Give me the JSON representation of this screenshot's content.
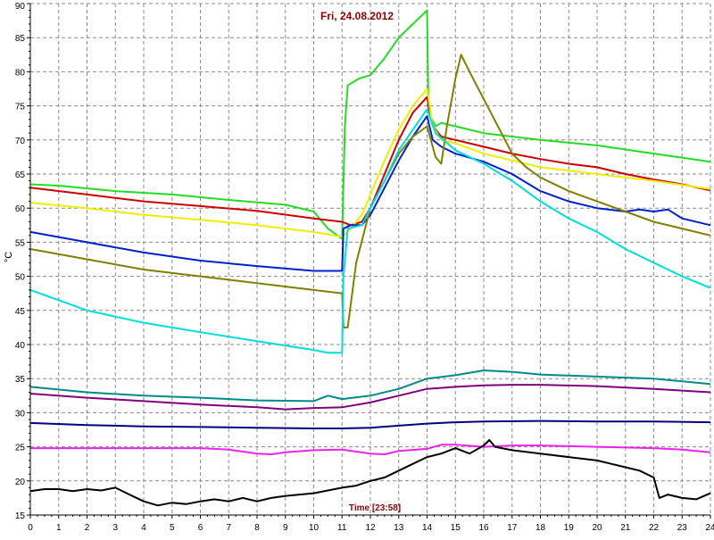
{
  "chart_data": {
    "type": "line",
    "title": "Fri, 24.08.2012",
    "ylabel": "°C",
    "xlabel": "Time [23:58]",
    "xlim": [
      0,
      24
    ],
    "ylim": [
      15,
      90
    ],
    "x_ticks": [
      0,
      1,
      2,
      3,
      4,
      5,
      6,
      7,
      8,
      9,
      10,
      11,
      12,
      13,
      14,
      15,
      16,
      17,
      18,
      19,
      20,
      21,
      22,
      23,
      24
    ],
    "y_ticks": [
      15,
      20,
      25,
      30,
      35,
      40,
      45,
      50,
      55,
      60,
      65,
      70,
      75,
      80,
      85,
      90
    ],
    "grid": true,
    "series": [
      {
        "color": "#22dd22",
        "points": [
          [
            0,
            63.5
          ],
          [
            1,
            63.3
          ],
          [
            3,
            62.5
          ],
          [
            5,
            62
          ],
          [
            7,
            61.2
          ],
          [
            9,
            60.5
          ],
          [
            10,
            59.5
          ],
          [
            10.5,
            57
          ],
          [
            11,
            55.5
          ],
          [
            11.1,
            72
          ],
          [
            11.2,
            78
          ],
          [
            11.6,
            79
          ],
          [
            12,
            79.5
          ],
          [
            12.5,
            82
          ],
          [
            13,
            85
          ],
          [
            13.5,
            87
          ],
          [
            14,
            89
          ],
          [
            14.05,
            74
          ],
          [
            14.3,
            72
          ],
          [
            14.5,
            72.5
          ],
          [
            15,
            72
          ],
          [
            16,
            71
          ],
          [
            18,
            70
          ],
          [
            20,
            69.2
          ],
          [
            22,
            68
          ],
          [
            24,
            66.8
          ]
        ]
      },
      {
        "color": "#cc0000",
        "points": [
          [
            0,
            63
          ],
          [
            2,
            62
          ],
          [
            4,
            61
          ],
          [
            6,
            60.3
          ],
          [
            8,
            59.6
          ],
          [
            10,
            58.5
          ],
          [
            11,
            58
          ],
          [
            11.3,
            57.5
          ],
          [
            11.7,
            58
          ],
          [
            12,
            60
          ],
          [
            12.5,
            65
          ],
          [
            13,
            70
          ],
          [
            13.5,
            74
          ],
          [
            14,
            76.3
          ],
          [
            14.2,
            72
          ],
          [
            14.5,
            70.5
          ],
          [
            15,
            70
          ],
          [
            16,
            69
          ],
          [
            17,
            68
          ],
          [
            18,
            67.2
          ],
          [
            19,
            66.5
          ],
          [
            20,
            66
          ],
          [
            21,
            65
          ],
          [
            22,
            64.2
          ],
          [
            23,
            63.5
          ],
          [
            24,
            62.6
          ]
        ]
      },
      {
        "color": "#eeee00",
        "points": [
          [
            0,
            60.8
          ],
          [
            2,
            60
          ],
          [
            4,
            59
          ],
          [
            6,
            58.3
          ],
          [
            8,
            57.5
          ],
          [
            10,
            56.5
          ],
          [
            11,
            55.8
          ],
          [
            11.3,
            57
          ],
          [
            11.7,
            59
          ],
          [
            12,
            62
          ],
          [
            12.5,
            67
          ],
          [
            13,
            71.5
          ],
          [
            13.5,
            75
          ],
          [
            14,
            77.5
          ],
          [
            14.2,
            72
          ],
          [
            14.5,
            70
          ],
          [
            15,
            69.5
          ],
          [
            16,
            68
          ],
          [
            17,
            67
          ],
          [
            18,
            66
          ],
          [
            20,
            65
          ],
          [
            22,
            64
          ],
          [
            24,
            62.8
          ]
        ]
      },
      {
        "color": "#0022cc",
        "points": [
          [
            0,
            56.5
          ],
          [
            2,
            55
          ],
          [
            4,
            53.5
          ],
          [
            6,
            52.3
          ],
          [
            8,
            51.5
          ],
          [
            10,
            50.8
          ],
          [
            11,
            50.8
          ],
          [
            11.05,
            57
          ],
          [
            11.3,
            57.5
          ],
          [
            11.7,
            57.5
          ],
          [
            12,
            59
          ],
          [
            12.5,
            63
          ],
          [
            13,
            67
          ],
          [
            13.5,
            70.5
          ],
          [
            14,
            73.5
          ],
          [
            14.2,
            70
          ],
          [
            14.5,
            69
          ],
          [
            15,
            68
          ],
          [
            16,
            66.8
          ],
          [
            17,
            65
          ],
          [
            18,
            62.5
          ],
          [
            19,
            61
          ],
          [
            20,
            60
          ],
          [
            21,
            59.5
          ],
          [
            21.5,
            59.8
          ],
          [
            22,
            59.5
          ],
          [
            22.5,
            59.8
          ],
          [
            23,
            58.5
          ],
          [
            24,
            57.5
          ]
        ]
      },
      {
        "color": "#808000",
        "points": [
          [
            0,
            54
          ],
          [
            2,
            52.5
          ],
          [
            4,
            51
          ],
          [
            6,
            50
          ],
          [
            8,
            49
          ],
          [
            10,
            48
          ],
          [
            11,
            47.5
          ],
          [
            11.05,
            42.5
          ],
          [
            11.2,
            42.5
          ],
          [
            11.5,
            52
          ],
          [
            12,
            60
          ],
          [
            12.5,
            64
          ],
          [
            13,
            68
          ],
          [
            13.5,
            70.5
          ],
          [
            14,
            72
          ],
          [
            14.3,
            67.5
          ],
          [
            14.5,
            66.5
          ],
          [
            14.7,
            72
          ],
          [
            15,
            79
          ],
          [
            15.2,
            82.5
          ],
          [
            15.5,
            80
          ],
          [
            16,
            76
          ],
          [
            16.5,
            72
          ],
          [
            17,
            68
          ],
          [
            17.5,
            66
          ],
          [
            18,
            64.5
          ],
          [
            19,
            62.5
          ],
          [
            20,
            61
          ],
          [
            21,
            59.5
          ],
          [
            22,
            58
          ],
          [
            23,
            57
          ],
          [
            24,
            56
          ]
        ]
      },
      {
        "color": "#00dddd",
        "points": [
          [
            0,
            48
          ],
          [
            1,
            46.5
          ],
          [
            2,
            45
          ],
          [
            4,
            43.2
          ],
          [
            6,
            41.8
          ],
          [
            8,
            40.5
          ],
          [
            10,
            39.2
          ],
          [
            10.5,
            38.8
          ],
          [
            11,
            38.8
          ],
          [
            11.05,
            50
          ],
          [
            11.2,
            57
          ],
          [
            11.7,
            57.5
          ],
          [
            12,
            60
          ],
          [
            12.5,
            64
          ],
          [
            13,
            68.5
          ],
          [
            13.5,
            71.5
          ],
          [
            14,
            74.5
          ],
          [
            14.3,
            71
          ],
          [
            15,
            68.5
          ],
          [
            16,
            66.5
          ],
          [
            17,
            64
          ],
          [
            18,
            61
          ],
          [
            19,
            58.5
          ],
          [
            20,
            56.5
          ],
          [
            21,
            54
          ],
          [
            22,
            52
          ],
          [
            23,
            50
          ],
          [
            24,
            48.3
          ]
        ]
      },
      {
        "color": "#008b8b",
        "points": [
          [
            0,
            33.8
          ],
          [
            2,
            33
          ],
          [
            4,
            32.5
          ],
          [
            6,
            32.2
          ],
          [
            8,
            31.8
          ],
          [
            10,
            31.7
          ],
          [
            10.5,
            32.5
          ],
          [
            11,
            32
          ],
          [
            12,
            32.5
          ],
          [
            13,
            33.5
          ],
          [
            14,
            35
          ],
          [
            15,
            35.5
          ],
          [
            16,
            36.2
          ],
          [
            17,
            36
          ],
          [
            18,
            35.6
          ],
          [
            20,
            35.3
          ],
          [
            22,
            35
          ],
          [
            24,
            34.2
          ]
        ]
      },
      {
        "color": "#800080",
        "points": [
          [
            0,
            32.8
          ],
          [
            2,
            32.2
          ],
          [
            4,
            31.7
          ],
          [
            6,
            31.2
          ],
          [
            8,
            30.8
          ],
          [
            9,
            30.5
          ],
          [
            10,
            30.7
          ],
          [
            11,
            30.8
          ],
          [
            12,
            31.5
          ],
          [
            13,
            32.5
          ],
          [
            14,
            33.5
          ],
          [
            15,
            33.8
          ],
          [
            16,
            34
          ],
          [
            17,
            34.1
          ],
          [
            18,
            34.1
          ],
          [
            20,
            33.9
          ],
          [
            22,
            33.5
          ],
          [
            24,
            33
          ]
        ]
      },
      {
        "color": "#000080",
        "points": [
          [
            0,
            28.5
          ],
          [
            2,
            28.2
          ],
          [
            4,
            28
          ],
          [
            6,
            27.9
          ],
          [
            8,
            27.8
          ],
          [
            10,
            27.7
          ],
          [
            11,
            27.7
          ],
          [
            12,
            27.8
          ],
          [
            13,
            28.1
          ],
          [
            14,
            28.4
          ],
          [
            15,
            28.6
          ],
          [
            16,
            28.7
          ],
          [
            18,
            28.8
          ],
          [
            20,
            28.7
          ],
          [
            22,
            28.7
          ],
          [
            24,
            28.6
          ]
        ]
      },
      {
        "color": "#ee22ee",
        "points": [
          [
            0,
            24.8
          ],
          [
            2,
            24.8
          ],
          [
            4,
            24.8
          ],
          [
            6,
            24.8
          ],
          [
            7,
            24.6
          ],
          [
            8,
            24
          ],
          [
            8.5,
            23.9
          ],
          [
            9,
            24.2
          ],
          [
            10,
            24.5
          ],
          [
            11,
            24.6
          ],
          [
            12,
            24
          ],
          [
            12.5,
            23.9
          ],
          [
            13,
            24.4
          ],
          [
            14,
            24.7
          ],
          [
            14.5,
            25.3
          ],
          [
            15,
            25.3
          ],
          [
            16,
            25
          ],
          [
            17,
            25.2
          ],
          [
            18,
            25.2
          ],
          [
            20,
            25
          ],
          [
            22,
            24.8
          ],
          [
            23,
            24.6
          ],
          [
            24,
            24.2
          ]
        ]
      },
      {
        "color": "#000000",
        "points": [
          [
            0,
            18.5
          ],
          [
            0.5,
            18.8
          ],
          [
            1,
            18.8
          ],
          [
            1.5,
            18.5
          ],
          [
            2,
            18.8
          ],
          [
            2.5,
            18.6
          ],
          [
            3,
            19
          ],
          [
            3.5,
            18
          ],
          [
            4,
            17
          ],
          [
            4.5,
            16.4
          ],
          [
            5,
            16.8
          ],
          [
            5.5,
            16.6
          ],
          [
            6,
            17
          ],
          [
            6.5,
            17.3
          ],
          [
            7,
            17
          ],
          [
            7.5,
            17.5
          ],
          [
            8,
            17
          ],
          [
            8.5,
            17.5
          ],
          [
            9,
            17.8
          ],
          [
            10,
            18.2
          ],
          [
            11,
            19
          ],
          [
            11.5,
            19.3
          ],
          [
            12,
            20
          ],
          [
            12.5,
            20.5
          ],
          [
            13,
            21.5
          ],
          [
            13.5,
            22.5
          ],
          [
            14,
            23.5
          ],
          [
            14.5,
            24
          ],
          [
            15,
            24.8
          ],
          [
            15.5,
            24
          ],
          [
            16,
            25.2
          ],
          [
            16.2,
            26
          ],
          [
            16.4,
            25
          ],
          [
            17,
            24.5
          ],
          [
            18,
            24
          ],
          [
            19,
            23.5
          ],
          [
            20,
            23
          ],
          [
            20.5,
            22.5
          ],
          [
            21,
            22
          ],
          [
            21.5,
            21.5
          ],
          [
            22,
            20.5
          ],
          [
            22.2,
            17.5
          ],
          [
            22.5,
            18
          ],
          [
            23,
            17.5
          ],
          [
            23.5,
            17.3
          ],
          [
            24,
            18.2
          ]
        ]
      }
    ]
  }
}
